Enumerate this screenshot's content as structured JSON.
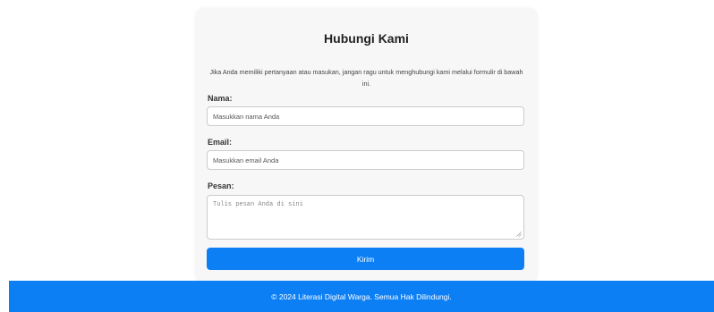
{
  "contact": {
    "title": "Hubungi Kami",
    "description": "Jika Anda memiliki pertanyaan atau masukan, jangan ragu untuk menghubungi kami melalui formulir di bawah ini.",
    "name_label": "Nama:",
    "name_placeholder": "Masukkan nama Anda",
    "email_label": "Email:",
    "email_placeholder": "Masukkan email Anda",
    "message_label": "Pesan:",
    "message_placeholder": "Tulis pesan Anda di sini",
    "submit_label": "Kirim"
  },
  "footer": {
    "text": "© 2024 Literasi Digital Warga. Semua Hak Dilindungi."
  },
  "colors": {
    "accent": "#0d7ff5",
    "card_bg": "#f7f7f7"
  }
}
